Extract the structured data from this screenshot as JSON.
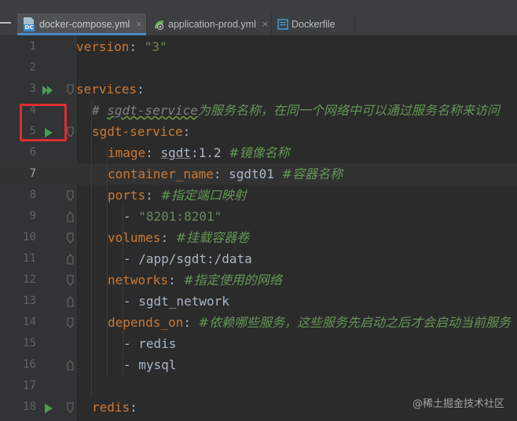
{
  "tabs": [
    {
      "label": "docker-compose.yml",
      "icon": "docker-compose-file-icon",
      "active": true
    },
    {
      "label": "application-prod.yml",
      "icon": "spring-yaml-file-icon",
      "active": false
    },
    {
      "label": "Dockerfile",
      "icon": "dockerfile-icon",
      "active": false
    }
  ],
  "icon_badge": "DC",
  "close_glyph": "×",
  "lines": [
    {
      "num": "1"
    },
    {
      "num": "2"
    },
    {
      "num": "3"
    },
    {
      "num": "4"
    },
    {
      "num": "5"
    },
    {
      "num": "6"
    },
    {
      "num": "7"
    },
    {
      "num": "8"
    },
    {
      "num": "9"
    },
    {
      "num": "10"
    },
    {
      "num": "11"
    },
    {
      "num": "12"
    },
    {
      "num": "13"
    },
    {
      "num": "14"
    },
    {
      "num": "15"
    },
    {
      "num": "16"
    },
    {
      "num": "17"
    },
    {
      "num": "18"
    }
  ],
  "code": {
    "l1": {
      "key": "version",
      "colon": ": ",
      "value": "\"3\""
    },
    "l3": {
      "key": "services",
      "colon": ":"
    },
    "l4": {
      "hash": "# ",
      "name": "sgdt-service",
      "text": "为服务名称，在同一个网络中可以通过服务名称来访问"
    },
    "l5": {
      "key": "sgdt-service",
      "colon": ":"
    },
    "l6": {
      "key": "image",
      "colon": ": ",
      "img": "sgdt",
      "tag": ":1.2 ",
      "comment": "#镜像名称"
    },
    "l7": {
      "key": "container_name",
      "colon": ": ",
      "value": "sgdt01 ",
      "comment": "#容器名称"
    },
    "l8": {
      "key": "ports",
      "colon": ": ",
      "comment": "#指定端口映射"
    },
    "l9": {
      "dash": "- ",
      "value": "\"8201:8201\""
    },
    "l10": {
      "key": "volumes",
      "colon": ": ",
      "comment": "#挂载容器卷"
    },
    "l11": {
      "dash": "- ",
      "value": "/app/sgdt:/data"
    },
    "l12": {
      "key": "networks",
      "colon": ": ",
      "comment": "#指定使用的网络"
    },
    "l13": {
      "dash": "- ",
      "value": "sgdt_network"
    },
    "l14": {
      "key": "depends_on",
      "colon": ": ",
      "comment": "#依赖哪些服务，这些服务先启动之后才会启动当前服务"
    },
    "l15": {
      "dash": "- ",
      "value": "redis"
    },
    "l16": {
      "dash": "- ",
      "value": "mysql"
    },
    "l18": {
      "key": "redis",
      "colon": ":"
    }
  },
  "current_line": 7,
  "watermark": "@稀土掘金技术社区",
  "colors": {
    "keyword": "#cc7832",
    "string": "#6a8759",
    "comment": "#629755",
    "run_icon": "#499c54",
    "highlight_box": "#e02d2d",
    "tab_active_underline": "#4a88c7"
  }
}
